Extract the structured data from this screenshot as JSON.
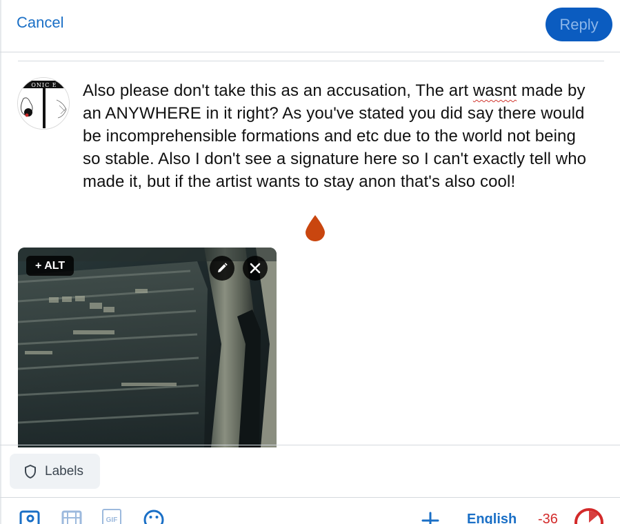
{
  "header": {
    "cancel_label": "Cancel",
    "reply_label": "Reply"
  },
  "post": {
    "text_before": "Also please don't take this as an accusation, The art ",
    "misspelled_word": "wasnt",
    "text_after": " made by an ANYWHERE in it right? As you've stated you did say there would be incomprehensible formations and etc due to the world not being so stable. Also I don't see a signature here so I can't exactly tell who made it, but if the artist wants to stay anon that's also cool!"
  },
  "avatar": {
    "logo_text": "ONIC E"
  },
  "attachment": {
    "alt_label": "+ ALT"
  },
  "labels_button": {
    "label": "Labels"
  },
  "toolbar": {
    "gif_label": "GIF",
    "language": "English",
    "char_remaining": "-36",
    "char_limit_progress": 1.0
  },
  "colors": {
    "accent": "#1a6fc6",
    "reply_bg": "#0b5cc0",
    "error": "#d32a2a",
    "drop": "#c9460f"
  },
  "icons": [
    "pencil-icon",
    "close-icon",
    "shield-icon",
    "image-icon",
    "video-icon",
    "gif-icon",
    "emoji-icon",
    "plus-icon",
    "water-drop-icon"
  ]
}
